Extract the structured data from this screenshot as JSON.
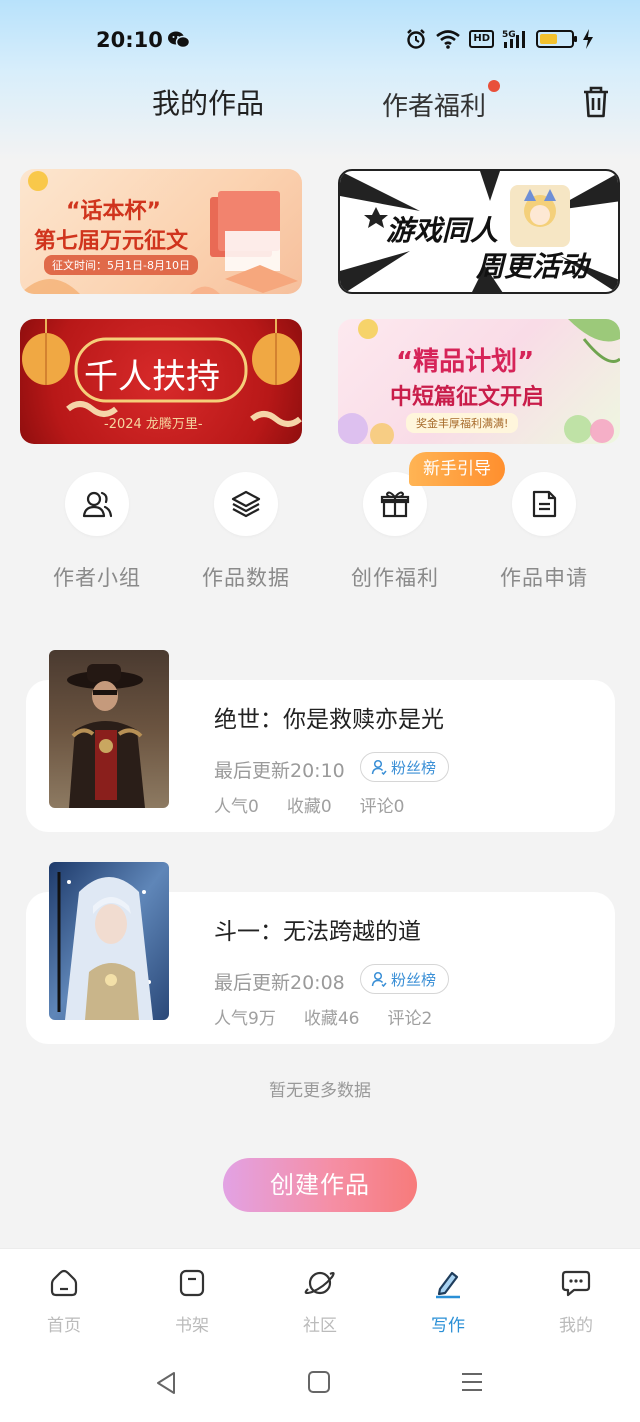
{
  "status_bar": {
    "time": "20:10",
    "network": "5G",
    "hd": "HD",
    "battery_level": 0.55,
    "icons": [
      "wechat-icon",
      "alarm-icon",
      "wifi-icon",
      "signal-icon",
      "battery-icon",
      "charging-icon"
    ]
  },
  "header": {
    "my_works": "我的作品",
    "author_welfare": "作者福利",
    "icons": [
      "trash-icon"
    ]
  },
  "banners": {
    "b1": {
      "line1": "“话本杯”",
      "line2": "第七届万元征文",
      "line3": "征文时间：5月1日-8月10日"
    },
    "b2": {
      "line1": "游戏同人",
      "line2": "周更活动"
    },
    "b3": {
      "line1": "千人扶持",
      "line2": "-2024 龙腾万里-"
    },
    "b4": {
      "line1": "“精品计划”",
      "line2": "中短篇征文开启",
      "line3": "奖金丰厚福利满满!"
    }
  },
  "quick_entries": [
    {
      "label": "作者小组",
      "icon": "people-icon"
    },
    {
      "label": "作品数据",
      "icon": "layers-icon"
    },
    {
      "label": "创作福利",
      "icon": "gift-icon"
    },
    {
      "label": "作品申请",
      "icon": "document-icon"
    }
  ],
  "guide_badge": "新手引导",
  "works": [
    {
      "title": "绝世：你是救赎亦是光",
      "updated": "最后更新20:10",
      "fans": "粉丝榜",
      "popularity": "人气0",
      "favorites": "收藏0",
      "comments": "评论0"
    },
    {
      "title": "斗一：无法跨越的道",
      "updated": "最后更新20:08",
      "fans": "粉丝榜",
      "popularity": "人气9万",
      "favorites": "收藏46",
      "comments": "评论2"
    }
  ],
  "no_more": "暂无更多数据",
  "create_button": "创建作品",
  "bottom_nav": [
    {
      "label": "首页",
      "icon": "home-icon",
      "active": false
    },
    {
      "label": "书架",
      "icon": "bookshelf-icon",
      "active": false
    },
    {
      "label": "社区",
      "icon": "planet-icon",
      "active": false
    },
    {
      "label": "写作",
      "icon": "pen-icon",
      "active": true
    },
    {
      "label": "我的",
      "icon": "chat-icon",
      "active": false
    }
  ],
  "colors": {
    "accent": "#2a8fd6",
    "badge_orange": "#ff9a36",
    "red_dot": "#e8503a"
  }
}
